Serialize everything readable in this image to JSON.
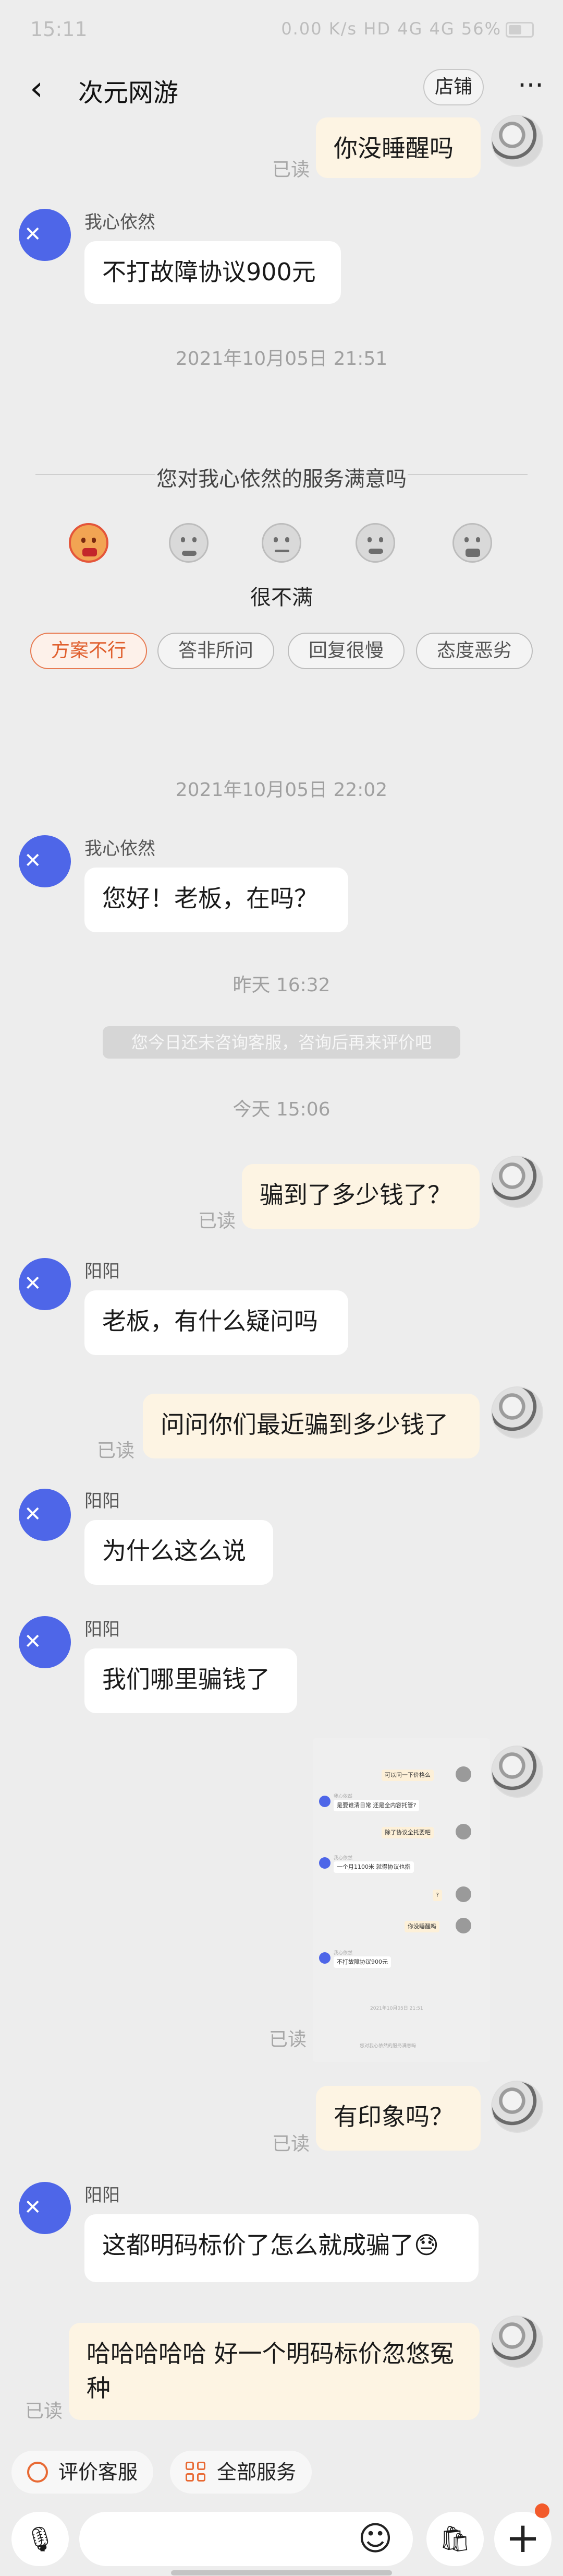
{
  "status": {
    "time": "15:11",
    "right_text": "0.00 K/s HD 4G 4G 56%"
  },
  "header": {
    "back_icon": "chevron-left-icon",
    "title": "次元网游",
    "shop_label": "店铺",
    "more_icon": "more-dots-icon"
  },
  "read_label": "已读",
  "messages": {
    "m0": {
      "text": "你没睡醒吗"
    },
    "m1": {
      "sender": "我心依然",
      "text": "不打故障协议900元"
    },
    "t1": "2021年10月05日 21:51",
    "t2": "2021年10月05日 22:02",
    "m2": {
      "sender": "我心依然",
      "text": "您好！老板，在吗？"
    },
    "t3": "昨天  16:32",
    "notice": "您今日还未咨询客服，咨询后再来评价吧",
    "t4": "今天  15:06",
    "m3": {
      "text": "骗到了多少钱了？"
    },
    "m4": {
      "sender": "阳阳",
      "text": "老板，有什么疑问吗"
    },
    "m5": {
      "text": "问问你们最近骗到多少钱了"
    },
    "m6": {
      "sender": "阳阳",
      "text": "为什么这么说"
    },
    "m7": {
      "sender": "阳阳",
      "text": "我们哪里骗钱了"
    },
    "m8": {
      "text": "有印象吗？"
    },
    "m9": {
      "sender": "阳阳",
      "text": "这都明码标价了怎么就成骗了😓"
    },
    "m10": {
      "text": "哈哈哈哈哈  好一个明码标价忽悠冤种"
    }
  },
  "satisfaction": {
    "question": "您对我心依然的服务满意吗",
    "selected_label": "很不满",
    "tags": [
      "方案不行",
      "答非所问",
      "回复很慢",
      "态度恶劣"
    ],
    "selected_tag": "方案不行"
  },
  "embed": {
    "b1": "可以问一下价格么",
    "b2": "是要谁清日常 还是全内容托管?",
    "b3": "除了协议全托要吧",
    "b4": "一个月1100米 就得协议也指",
    "b5": "?",
    "b6": "你没睡醒吗",
    "b7": "不打故障协议900元",
    "t1": "2021年10月05日 21:51",
    "q": "您对我心依然的服务满意吗",
    "sender": "我心依然"
  },
  "quick": {
    "rate": "评价客服",
    "all": "全部服务"
  },
  "input": {
    "placeholder": "",
    "mic_icon": "mic-icon",
    "emoji_icon": "emoji-icon",
    "bag_icon": "shopping-bag-icon",
    "plus_icon": "plus-icon"
  },
  "colors": {
    "accent": "#e86a34",
    "shop_avatar": "#4e66e8",
    "outgoing_bubble": "#fdf4e3",
    "incoming_bubble": "#ffffff"
  }
}
